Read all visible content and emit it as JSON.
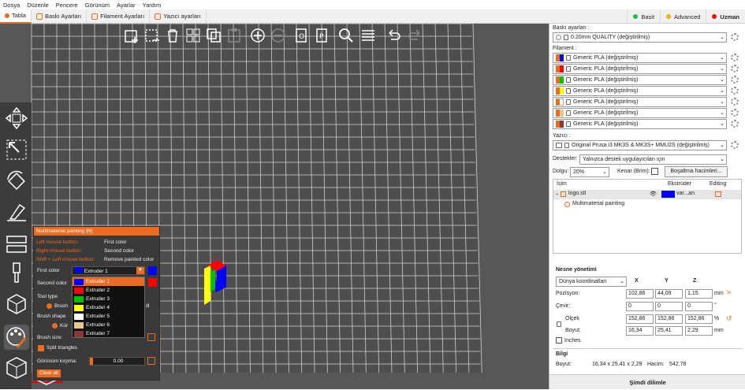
{
  "menu": [
    "Dosya",
    "Düzenle",
    "Pencere",
    "Görünüm",
    "Ayarlar",
    "Yardım"
  ],
  "tabs": [
    "Tabla",
    "Baskı Ayarları",
    "Filament Ayarları",
    "Yazıcı ayarları"
  ],
  "modes": [
    {
      "label": "Basit",
      "color": "#2db84d"
    },
    {
      "label": "Advanced",
      "color": "#e6b800"
    },
    {
      "label": "Uzman",
      "color": "#d91818"
    }
  ],
  "paint": {
    "title": "Multimaterial painting [N]",
    "left_key": "Left mouse button:",
    "left_val": "First color",
    "right_key": "Right mouse button:",
    "right_val": "Second color",
    "shift_key": "Shift + Left mouse button:",
    "shift_val": "Remove painted color",
    "first_color_label": "First color",
    "first_color_value": "Extruder 1",
    "second_color_label": "Second color",
    "tool_type_label": "Tool type",
    "tool_brush": "Brush",
    "tool_fill_fragment": "ill",
    "brush_shape_label": "Brush shape",
    "brush_shape_value": "Kür",
    "brush_size_label": "Brush size:",
    "split_triangles": "Split triangles",
    "clipping_label": "Görünüm kırpma:",
    "clipping_value": "0.00",
    "clear_all": "Clear all",
    "extruders": [
      {
        "name": "Extruder 1",
        "color": "#0000ff"
      },
      {
        "name": "Extruder 2",
        "color": "#ff0000"
      },
      {
        "name": "Extruder 3",
        "color": "#00c000"
      },
      {
        "name": "Extruder 4",
        "color": "#ffff00"
      },
      {
        "name": "Extruder 5",
        "color": "#ffffff"
      },
      {
        "name": "Extruder 6",
        "color": "#e6c88c"
      },
      {
        "name": "Extruder 7",
        "color": "#8b3a3a"
      }
    ]
  },
  "sidebar": {
    "print_label": "Baskı ayarları :",
    "print_value": "0.20mm QUALITY (değiştirilmiş)",
    "filament_label": "Filament :",
    "filaments": [
      {
        "name": "Generic PLA (değiştirilmiş)",
        "color": "#0000ff"
      },
      {
        "name": "Generic PLA (değiştirilmiş)",
        "color": "#ff0000"
      },
      {
        "name": "Generic PLA (değiştirilmiş)",
        "color": "#00c000"
      },
      {
        "name": "Generic PLA (değiştirilmiş)",
        "color": "#ffff00"
      },
      {
        "name": "Generic PLA (değiştirilmiş)",
        "color": "#ffffff"
      },
      {
        "name": "Generic PLA (değiştirilmiş)",
        "color": "#e6c88c"
      },
      {
        "name": "Generic PLA (değiştirilmiş)",
        "color": "#8b3a3a"
      }
    ],
    "printer_label": "Yazıcı :",
    "printer_value": "Original Prusa i3 MK3S & MK3S+ MMU2S (değiştirilmiş)",
    "support_label": "Destekler:",
    "support_value": "Yalnızca destek uygulayıcıları için",
    "infill_label": "Dolgu:",
    "infill_value": "20%",
    "brim_label": "Kenar (Brim):",
    "purge_button": "Boşaltma hacimleri...",
    "tree_headers": {
      "name": "İsim",
      "extruder": "Ekstrüder",
      "editing": "Editing"
    },
    "object_name": "logo.stl",
    "object_extruder": "var...an",
    "object_child": "Multimaterial painting",
    "manip_title": "Nesne yönetimi",
    "coord_value": "Dünya koordinatları",
    "axes": [
      "X",
      "Y",
      "Z"
    ],
    "position_label": "Pozisyon:",
    "position": [
      "102,86",
      "44,09",
      "1,15"
    ],
    "rotation_label": "Çevir:",
    "rotation": [
      "0",
      "0",
      "0"
    ],
    "scale_label": "Ölçek",
    "scale": [
      "152,86",
      "152,86",
      "152,86"
    ],
    "size_label": "Boyut:",
    "size": [
      "16,34",
      "25,41",
      "2,29"
    ],
    "unit_mm": "mm",
    "unit_deg": "°",
    "unit_pct": "%",
    "inches": "Inches",
    "info_title": "Bilgi",
    "info_size_label": "Boyut:",
    "info_size": "16,34 x 25,41 x 2,29",
    "volume_label": "Hacim:",
    "volume_value": "542,78",
    "slice_button": "Şimdi dilimle"
  }
}
